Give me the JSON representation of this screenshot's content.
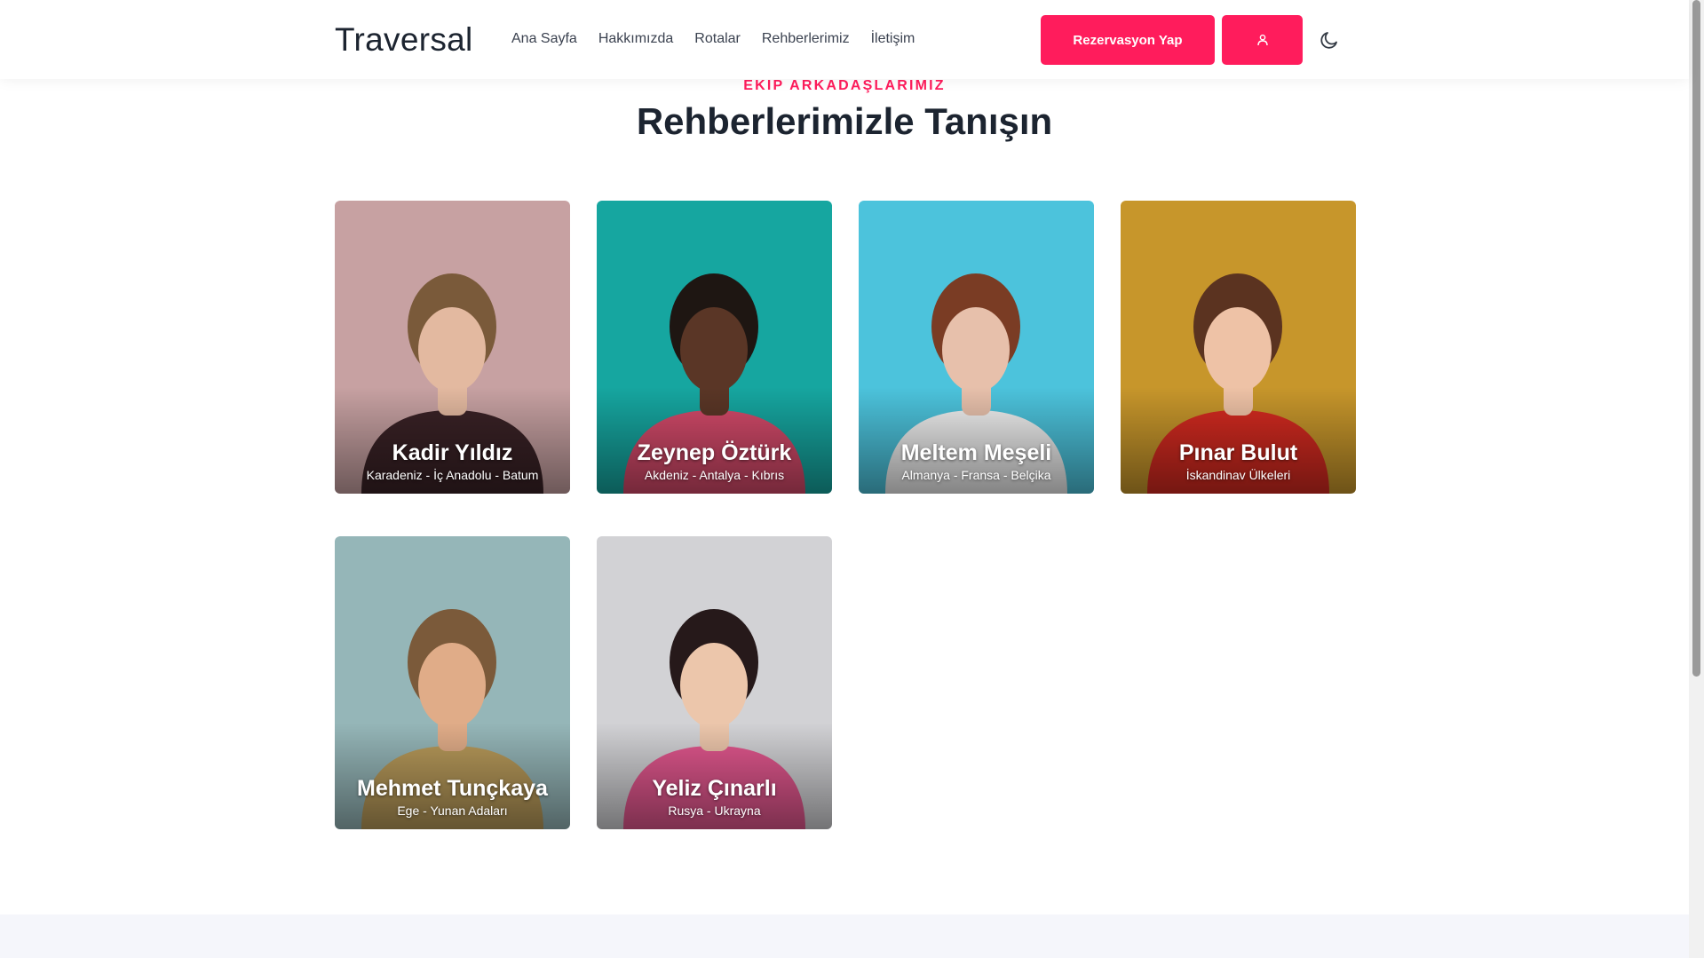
{
  "header": {
    "brand": "Traversal",
    "nav": [
      "Ana Sayfa",
      "Hakkımızda",
      "Rotalar",
      "Rehberlerimiz",
      "İletişim"
    ],
    "reserve_label": "Rezervasyon Yap",
    "icons": {
      "user": "user-icon",
      "theme": "moon-icon"
    },
    "accent": "#ff1c5c"
  },
  "section": {
    "eyebrow": "EKIP ARKADAŞLARIMIZ",
    "title": "Rehberlerimizle Tanışın"
  },
  "guides": [
    {
      "name": "Kadir Yıldız",
      "regions": "Karadeniz - İç Anadolu - Batum",
      "bg": "#c7a1a2",
      "skin": "#e3b9a0",
      "hair": "#7a5a3a",
      "shirt": "#3a2226"
    },
    {
      "name": "Zeynep Öztürk",
      "regions": "Akdeniz - Antalya - Kıbrıs",
      "bg": "#16a6a0",
      "skin": "#5a3626",
      "hair": "#1e1612",
      "shirt": "#d44a6a"
    },
    {
      "name": "Meltem Meşeli",
      "regions": "Almanya - Fransa - Belçika",
      "bg": "#4cc3dc",
      "skin": "#e7c0ab",
      "hair": "#7a3c24",
      "shirt": "#f0f0f0"
    },
    {
      "name": "Pınar Bulut",
      "regions": "İskandinav Ülkeleri",
      "bg": "#c7962b",
      "skin": "#eec2a6",
      "hair": "#5b3320",
      "shirt": "#d42a20"
    },
    {
      "name": "Mehmet Tunçkaya",
      "regions": "Ege - Yunan Adaları",
      "bg": "#95b6b8",
      "skin": "#e0ac88",
      "hair": "#7b5a3a",
      "shirt": "#b89a5a"
    },
    {
      "name": "Yeliz Çınarlı",
      "regions": "Rusya - Ukrayna",
      "bg": "#d2d2d5",
      "skin": "#ecc6ab",
      "hair": "#26191a",
      "shirt": "#e2578e"
    }
  ]
}
